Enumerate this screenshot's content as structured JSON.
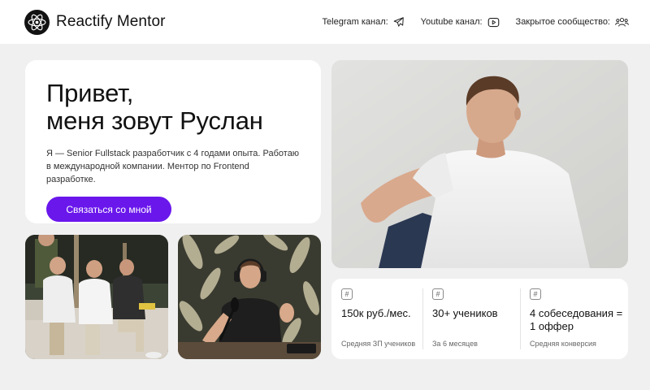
{
  "header": {
    "brand": "Reactify Mentor",
    "nav": [
      {
        "label": "Telegram канал:",
        "icon": "telegram-icon"
      },
      {
        "label": "Youtube канал:",
        "icon": "youtube-icon"
      },
      {
        "label": "Закрытое сообщество:",
        "icon": "community-icon"
      }
    ]
  },
  "intro": {
    "title_line1": "Привет,",
    "title_line2": "меня зовут Руслан",
    "description": "Я — Senior Fullstack разработчик с 4 годами опыта. Работаю в международной компании. Ментор по Frontend разработке.",
    "cta_label": "Связаться со мной"
  },
  "stats": [
    {
      "icon": "#",
      "value": "150к руб./мес.",
      "caption": "Средняя ЗП учеников"
    },
    {
      "icon": "#",
      "value": "30+ учеников",
      "caption": "За 6 месяцев"
    },
    {
      "icon": "#",
      "value": "4 собеседования = 1 оффер",
      "caption": "Средняя конверсия"
    }
  ],
  "colors": {
    "accent": "#6a17ec",
    "background": "#f0f0f0",
    "card": "#ffffff"
  }
}
